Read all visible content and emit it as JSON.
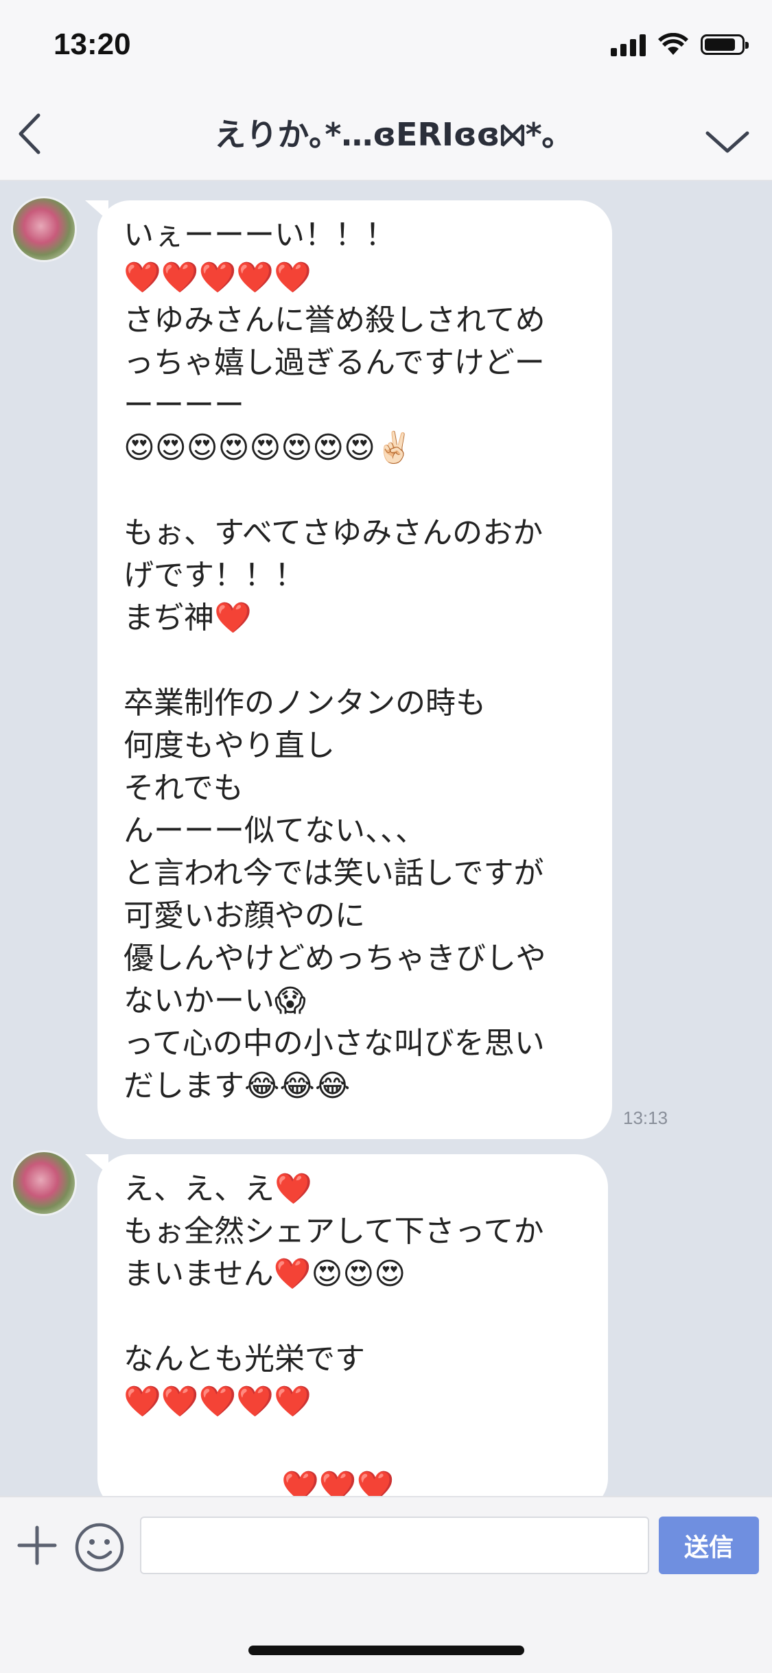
{
  "status_bar": {
    "time": "13:20"
  },
  "header": {
    "title": "えりか｡*…ɞERIɞɞ⨝*｡"
  },
  "messages": [
    {
      "time": "13:13",
      "lines": [
        "いぇーーーい！！！",
        "❤️❤️❤️❤️❤️",
        "さゆみさんに誉め殺しされてめ",
        "っちゃ嬉し過ぎるんですけどー",
        "ーーーー",
        "😍😍😍😍😍😍😍😍✌🏻",
        "",
        "もぉ、すべてさゆみさんのおか",
        "げです！！！",
        "まぢ神❤️",
        "",
        "卒業制作のノンタンの時も",
        "何度もやり直し",
        "それでも",
        "んーーー似てない、、、",
        "と言われ今では笑い話しですが",
        "可愛いお顔やのに",
        "優しんやけどめっちゃきびしや",
        "ないかーい😱",
        "って心の中の小さな叫びを思い",
        "だします😂😂😂"
      ]
    },
    {
      "lines": [
        "え、え、え❤️",
        "もぉ全然シェアして下さってか",
        "まいません❤️😍😍😍",
        "",
        "なんとも光栄です",
        "❤️❤️❤️❤️❤️",
        "",
        "❤️❤️❤️"
      ]
    }
  ],
  "input": {
    "placeholder": "",
    "send_label": "送信"
  },
  "icons": {
    "back": "chevron-left-icon",
    "menu": "chevron-down-icon",
    "plus": "plus-icon",
    "emoji": "smiley-icon"
  }
}
